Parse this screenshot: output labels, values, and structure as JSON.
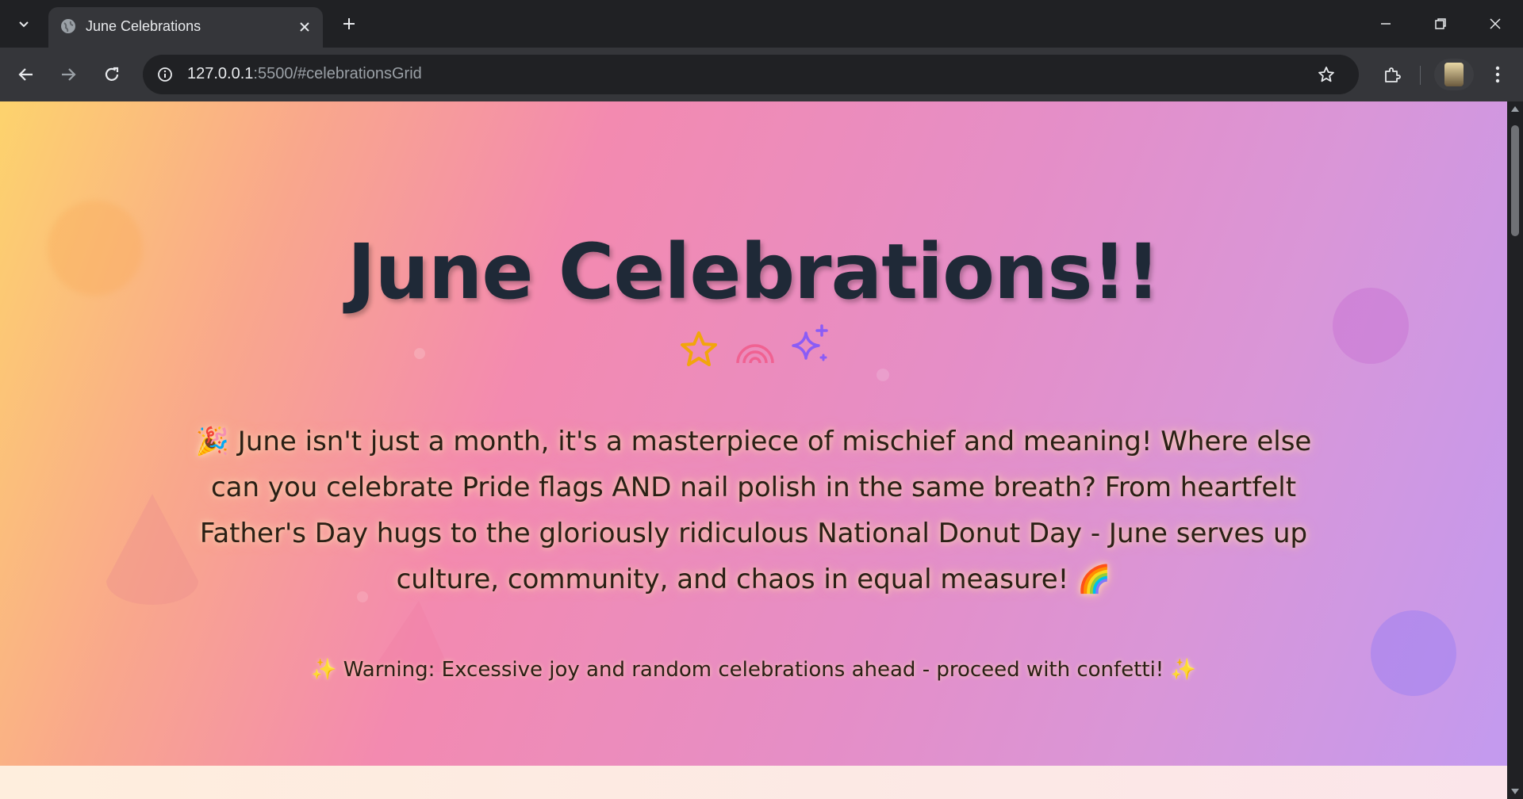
{
  "browser": {
    "tab": {
      "title": "June Celebrations"
    },
    "url": {
      "host": "127.0.0.1",
      "rest": ":5500/#celebrationsGrid"
    }
  },
  "page": {
    "title": "June Celebrations!!",
    "icons": [
      "star-icon",
      "rainbow-icon",
      "sparkles-icon"
    ],
    "intro": "🎉 June isn't just a month, it's a masterpiece of mischief and meaning! Where else can you celebrate Pride flags AND nail polish in the same breath? From heartfelt Father's Day hugs to the gloriously ridiculous National Donut Day - June serves up culture, community, and chaos in equal measure! 🌈",
    "warning": "✨ Warning: Excessive joy and random celebrations ahead - proceed with confetti! ✨"
  },
  "colors": {
    "title": "#1f2937",
    "star": "#f2a50c",
    "rainbow": "#f06292",
    "sparkles": "#8b5cf6"
  }
}
